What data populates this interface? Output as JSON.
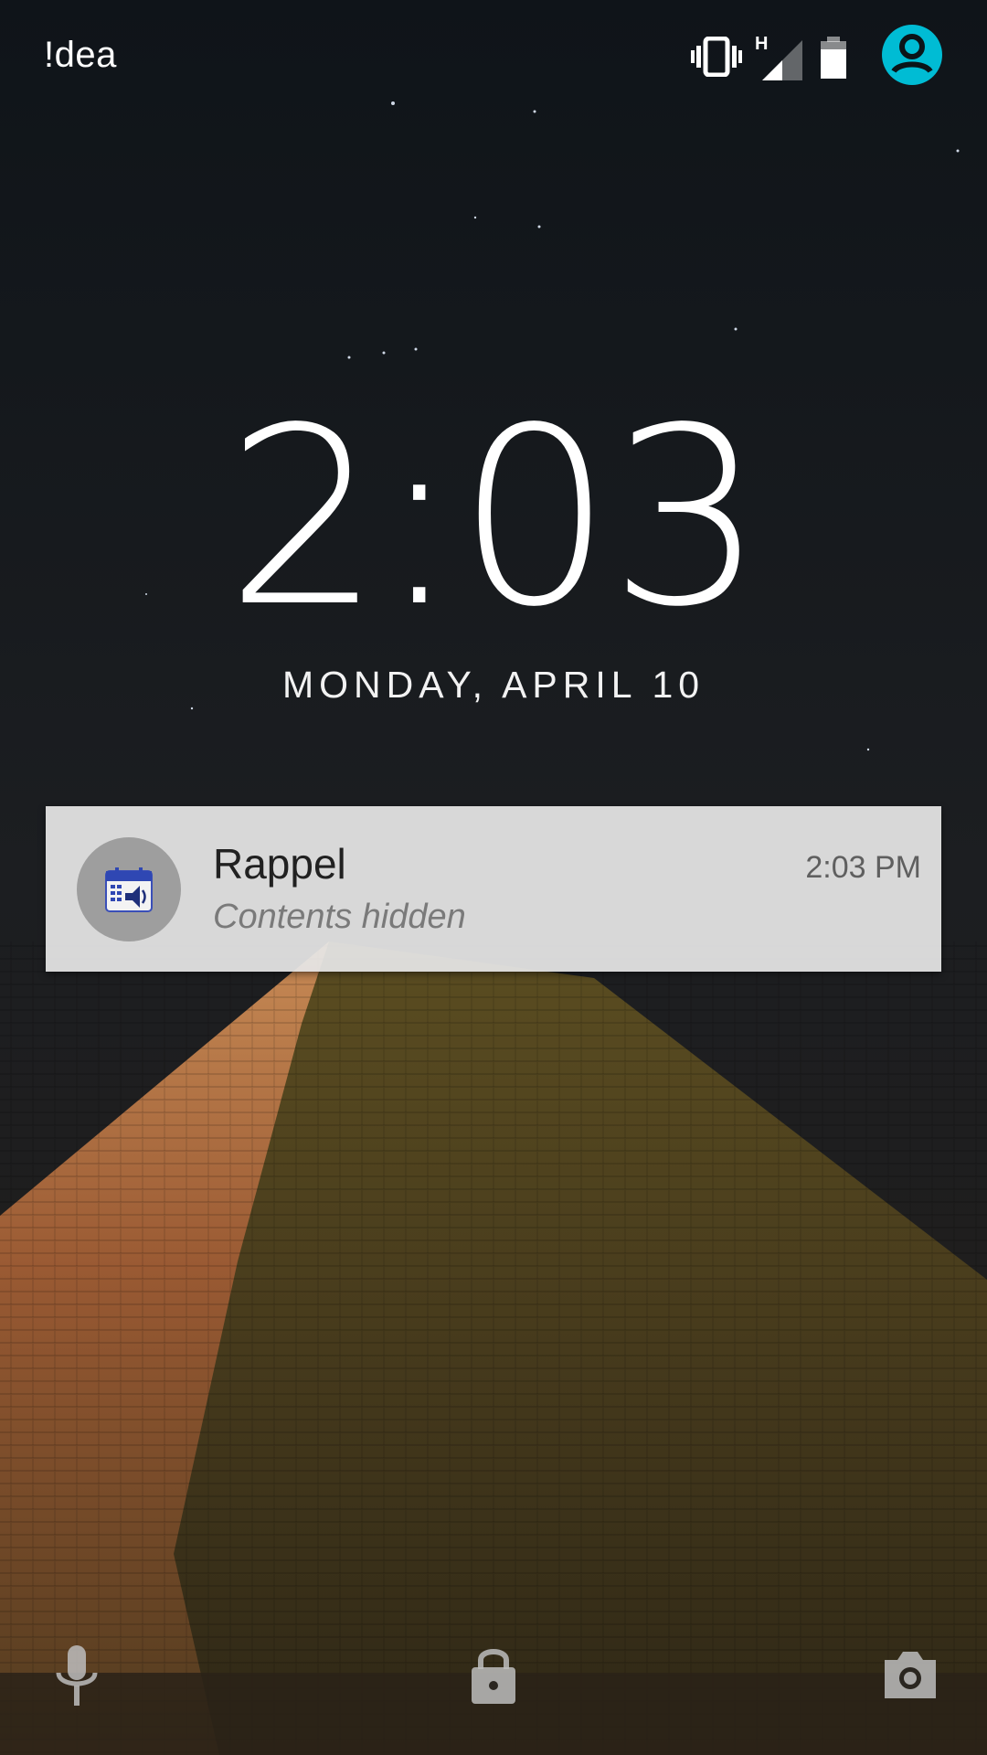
{
  "status_bar": {
    "carrier": "!dea",
    "network_type": "H",
    "icons": [
      "vibrate-icon",
      "signal-icon",
      "battery-icon",
      "user-avatar-icon"
    ],
    "avatar_color": "#00bcd4"
  },
  "lockscreen": {
    "time": "2:03",
    "date": "MONDAY, APRIL 10"
  },
  "notification": {
    "app_icon": "calendar-reminder-icon",
    "title": "Rappel",
    "time": "2:03 PM",
    "text": "Contents hidden"
  },
  "bottom_actions": {
    "left": "mic-icon",
    "center": "lock-icon",
    "right": "camera-icon"
  }
}
